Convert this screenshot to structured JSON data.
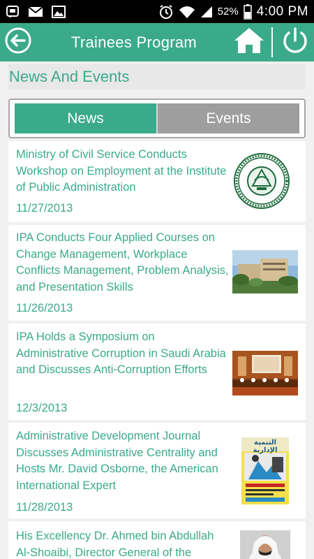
{
  "status_bar": {
    "battery_percent": "52%",
    "time": "4:00 PM",
    "icons_left": [
      "bbm-icon",
      "mail-icon",
      "image-icon"
    ],
    "icons_right": [
      "alarm-icon",
      "wifi-icon",
      "signal-icon",
      "battery-icon"
    ]
  },
  "app_bar": {
    "title": "Trainees Program",
    "back_icon": "back-arrow-icon",
    "home_icon": "home-icon",
    "power_icon": "power-icon",
    "color": "#3aaa8a"
  },
  "section": {
    "title": "News And Events"
  },
  "tabs": [
    {
      "label": "News",
      "active": true
    },
    {
      "label": "Events",
      "active": false
    }
  ],
  "news": [
    {
      "title": "Ministry of Civil Service Conducts Workshop on Employment at the Institute of Public Administration",
      "date": "11/27/2013",
      "thumb": "ipa-seal-logo"
    },
    {
      "title": "IPA Conducts Four Applied Courses on Change Management, Workplace Conflicts Management, Problem Analysis, and Presentation Skills",
      "date": "11/26/2013",
      "thumb": "building-photo"
    },
    {
      "title": "IPA Holds a Symposium on Administrative Corruption in Saudi Arabia and Discusses Anti-Corruption Efforts",
      "date": "12/3/2013",
      "thumb": "symposium-photo"
    },
    {
      "title": "Administrative Development Journal Discusses Administrative Centrality and Hosts Mr. David Osborne, the American International Expert",
      "date": "11/28/2013",
      "thumb": "journal-cover"
    },
    {
      "title": "His Excellency Dr. Ahmed bin Abdullah Al-Shoaibi, Director General of the",
      "date": "",
      "thumb": "portrait-photo"
    }
  ],
  "journal_cover_text": "التنمية الإدارية"
}
